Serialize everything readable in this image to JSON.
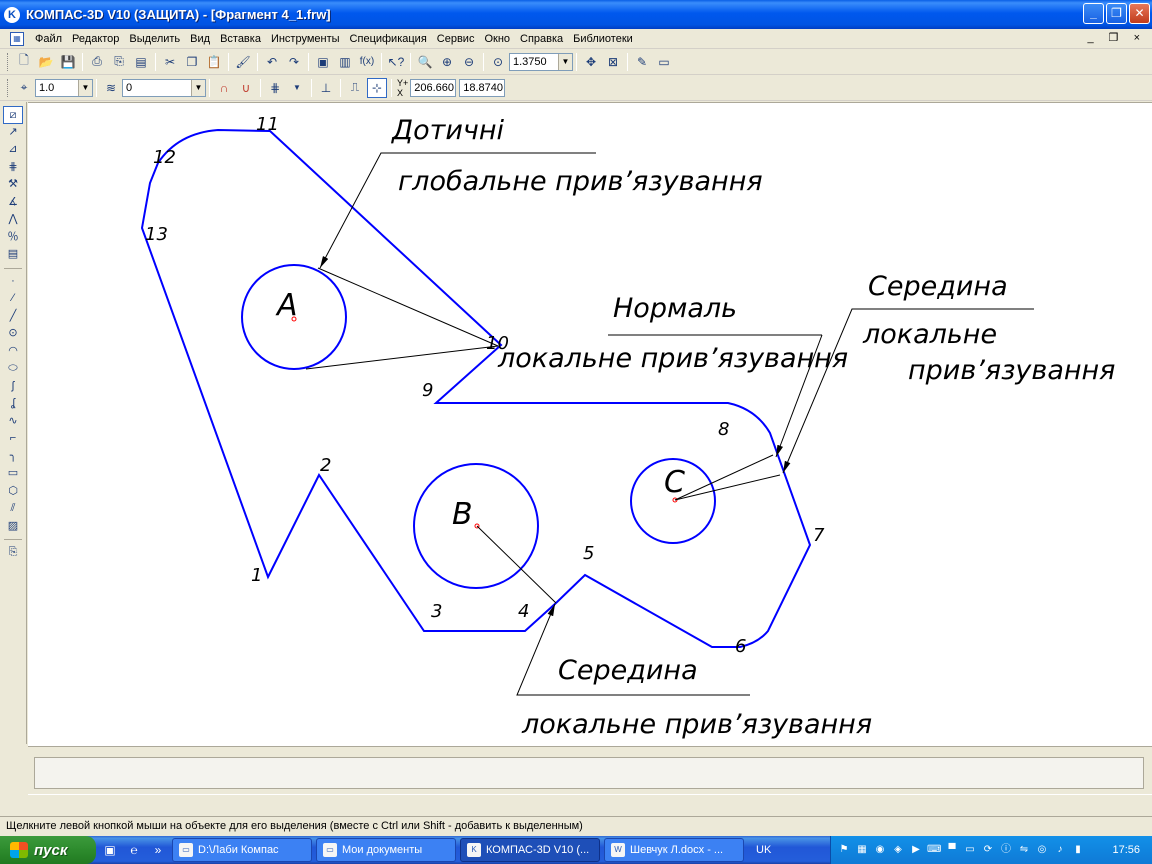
{
  "window": {
    "title": "КОМПАС-3D V10 (ЗАЩИТА) - [Фрагмент 4_1.frw]",
    "minimize_glyph": "_",
    "restore_glyph": "❐",
    "close_glyph": "✕"
  },
  "menu": {
    "items": [
      "Файл",
      "Редактор",
      "Выделить",
      "Вид",
      "Вставка",
      "Инструменты",
      "Спецификация",
      "Сервис",
      "Окно",
      "Справка",
      "Библиотеки"
    ],
    "mdi_controls": "_ ❐ ×"
  },
  "toolbar_standard": {
    "zoom_value": "1.3750"
  },
  "toolbar_current_state": {
    "step_value": "1.0",
    "layer_value": "0",
    "coord_x": "206.660",
    "coord_y": "18.8740"
  },
  "drawing": {
    "colors": {
      "contour": "#0000ff",
      "annotation": "#000000",
      "center_mark": "#ff0000"
    },
    "vertex_labels": [
      "1",
      "2",
      "3",
      "4",
      "5",
      "6",
      "7",
      "8",
      "9",
      "10",
      "11",
      "12",
      "13"
    ],
    "circle_labels": {
      "a": "A",
      "b": "B",
      "c": "C"
    },
    "callouts": {
      "tangent_title": "Дотичні",
      "tangent_subtitle": "глобальне прив’язування",
      "normal_title": "Нормаль",
      "normal_subtitle": "локальне прив’язування",
      "middle_right_title": "Середина",
      "middle_right_line1": "локальне",
      "middle_right_line2": "прив’язування",
      "middle_bottom_title": "Середина",
      "middle_bottom_subtitle": "локальне прив’язування"
    }
  },
  "status": {
    "message": "Щелкните левой кнопкой мыши на объекте для его выделения (вместе с Ctrl или Shift - добавить к выделенным)"
  },
  "taskbar": {
    "start_label": "пуск",
    "tasks": [
      {
        "label": "D:\\Лаби Компас",
        "active": false
      },
      {
        "label": "Мои документы",
        "active": false
      },
      {
        "label": "КОМПАС-3D V10 (...",
        "active": true
      },
      {
        "label": "Шевчук Л.docx - ...",
        "active": false
      }
    ],
    "language": "UK",
    "clock": "17:56"
  }
}
